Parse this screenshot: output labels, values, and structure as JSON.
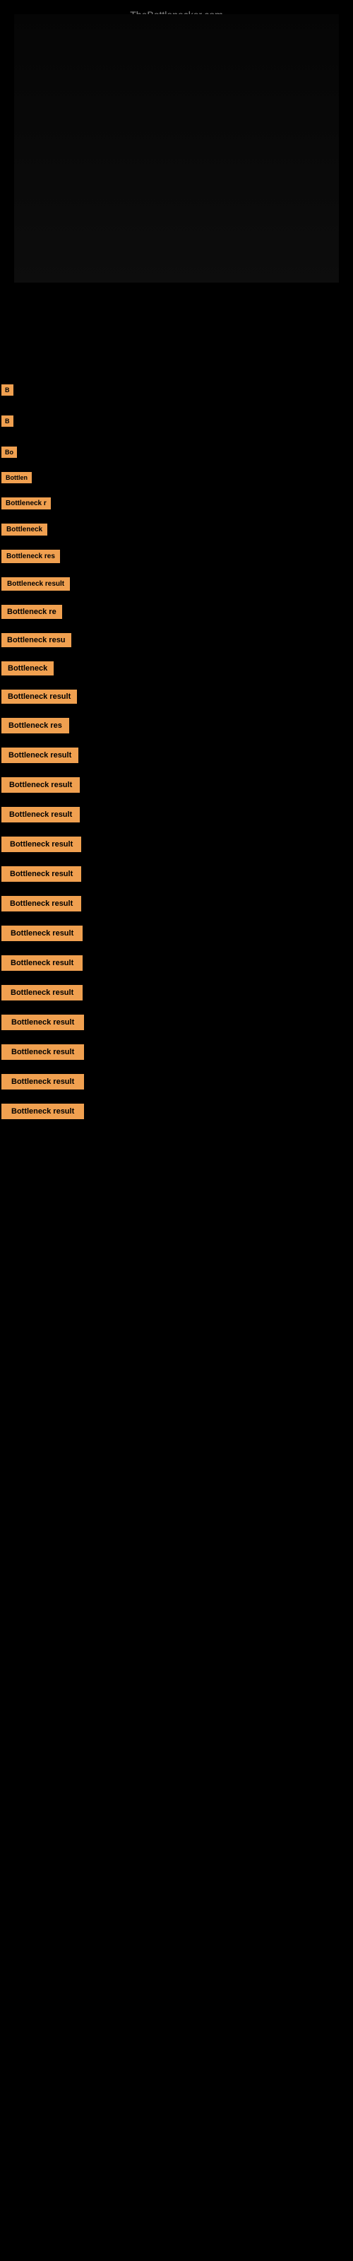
{
  "site": {
    "title": "TheBottlenecker.com"
  },
  "results": [
    {
      "id": 1,
      "label": "B",
      "short": true
    },
    {
      "id": 2,
      "label": "B",
      "short": true
    },
    {
      "id": 3,
      "label": "Bo",
      "short": true
    },
    {
      "id": 4,
      "label": "Bottlen",
      "short": true
    },
    {
      "id": 5,
      "label": "Bottleneck r",
      "medium": true
    },
    {
      "id": 6,
      "label": "Bottleneck",
      "medium": true
    },
    {
      "id": 7,
      "label": "Bottleneck res",
      "medium": true
    },
    {
      "id": 8,
      "label": "Bottleneck result",
      "full": true
    },
    {
      "id": 9,
      "label": "Bottleneck re",
      "medium": true
    },
    {
      "id": 10,
      "label": "Bottleneck resu",
      "medium": true
    },
    {
      "id": 11,
      "label": "Bottleneck",
      "medium": true
    },
    {
      "id": 12,
      "label": "Bottleneck result",
      "full": true
    },
    {
      "id": 13,
      "label": "Bottleneck res",
      "medium": true
    },
    {
      "id": 14,
      "label": "Bottleneck result",
      "full": true
    },
    {
      "id": 15,
      "label": "Bottleneck result",
      "full": true
    },
    {
      "id": 16,
      "label": "Bottleneck result",
      "full": true
    },
    {
      "id": 17,
      "label": "Bottleneck result",
      "full": true
    },
    {
      "id": 18,
      "label": "Bottleneck result",
      "full": true
    },
    {
      "id": 19,
      "label": "Bottleneck result",
      "full": true
    },
    {
      "id": 20,
      "label": "Bottleneck result",
      "full": true
    },
    {
      "id": 21,
      "label": "Bottleneck result",
      "full": true
    },
    {
      "id": 22,
      "label": "Bottleneck result",
      "full": true
    },
    {
      "id": 23,
      "label": "Bottleneck result",
      "full": true
    },
    {
      "id": 24,
      "label": "Bottleneck result",
      "full": true
    },
    {
      "id": 25,
      "label": "Bottleneck result",
      "full": true
    },
    {
      "id": 26,
      "label": "Bottleneck result",
      "full": true
    }
  ],
  "colors": {
    "background": "#000000",
    "badge": "#f0a050",
    "text": "#000000",
    "site_title": "#888888"
  }
}
